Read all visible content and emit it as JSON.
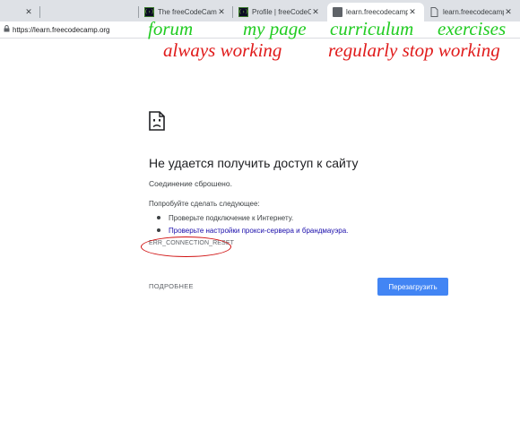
{
  "browser": {
    "tabs": [
      {
        "title": "",
        "favicon": "none",
        "active": false
      },
      {
        "title": "The freeCodeCamp Fo",
        "favicon": "fcc-icon",
        "active": false
      },
      {
        "title": "Profile | freeCodeCam",
        "favicon": "fcc-icon",
        "active": false
      },
      {
        "title": "learn.freecodecamp.o",
        "favicon": "page-dark-icon",
        "active": true
      },
      {
        "title": "learn.freecodecamp.o",
        "favicon": "page-icon",
        "active": false
      }
    ],
    "close_glyph": "✕",
    "address": {
      "url": "https://learn.freecodecamp.org"
    }
  },
  "annotations": {
    "green": [
      "forum",
      "my page",
      "curriculum",
      "exercises"
    ],
    "red": [
      "always working",
      "regularly stop working"
    ],
    "colors": {
      "green": "#22cc22",
      "red": "#e01a1a"
    }
  },
  "error_page": {
    "icon": "sad-page-icon",
    "title": "Не удается получить доступ к сайту",
    "subtitle": "Соединение сброшено.",
    "try_text": "Попробуйте сделать следующее:",
    "suggestions": [
      {
        "text": "Проверьте подключение к Интернету.",
        "link": false
      },
      {
        "text": "Проверьте настройки прокси-сервера и брандмауэра.",
        "link": true
      }
    ],
    "error_code": "ERR_CONNECTION_RESET",
    "details_label": "ПОДРОБНЕЕ",
    "reload_label": "Перезагрузить",
    "colors": {
      "button": "#4285f4",
      "link": "#1a0dab",
      "highlight_oval": "#d01010"
    }
  }
}
